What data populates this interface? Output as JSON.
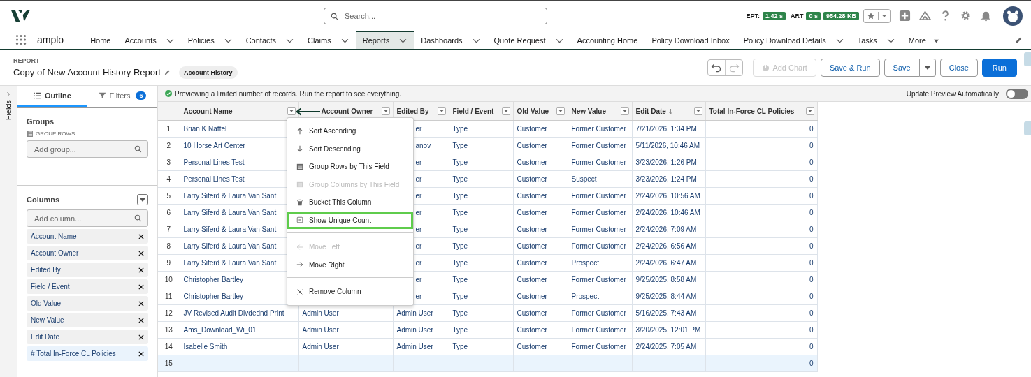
{
  "header": {
    "search_placeholder": "Search...",
    "metrics": [
      {
        "label": "EPT:",
        "value": "1.42 s"
      },
      {
        "label": "ART",
        "value": "0 s"
      },
      {
        "value": "954.28 KB"
      }
    ]
  },
  "nav": {
    "brand": "amplo",
    "items": [
      {
        "label": "Home",
        "menu": false,
        "selected": false
      },
      {
        "label": "Accounts",
        "menu": true,
        "selected": false
      },
      {
        "label": "Policies",
        "menu": true,
        "selected": false
      },
      {
        "label": "Contacts",
        "menu": true,
        "selected": false
      },
      {
        "label": "Claims",
        "menu": true,
        "selected": false
      },
      {
        "label": "Reports",
        "menu": true,
        "selected": true
      },
      {
        "label": "Dashboards",
        "menu": true,
        "selected": false
      },
      {
        "label": "Quote Request",
        "menu": true,
        "selected": false
      },
      {
        "label": "Accounting Home",
        "menu": false,
        "selected": false
      },
      {
        "label": "Policy Download Inbox",
        "menu": false,
        "selected": false
      },
      {
        "label": "Policy Download Details",
        "menu": true,
        "selected": false
      },
      {
        "label": "Tasks",
        "menu": true,
        "selected": false
      },
      {
        "label": "More",
        "menu": true,
        "selected": false,
        "kind": "more"
      }
    ]
  },
  "report": {
    "eyebrow": "REPORT",
    "title": "Copy of New Account History Report",
    "badge": "Account History",
    "buttons": [
      {
        "label": "Add Chart",
        "kind": "chart",
        "disabled": true
      },
      {
        "label": "Save & Run",
        "kind": "outline",
        "disabled": false
      },
      {
        "label": "Save",
        "kind": "split",
        "disabled": false
      },
      {
        "label": "Close",
        "kind": "outline",
        "disabled": false
      },
      {
        "label": "Run",
        "kind": "primary",
        "disabled": false
      }
    ]
  },
  "sidebar": {
    "rail_label": "Fields",
    "tabs": [
      {
        "label": "Outline",
        "selected": true
      },
      {
        "label": "Filters",
        "count": "6",
        "selected": false
      }
    ],
    "groups": {
      "title": "Groups",
      "subtitle": "GROUP ROWS",
      "placeholder": "Add group..."
    },
    "columns": {
      "title": "Columns",
      "placeholder": "Add column...",
      "items": [
        {
          "label": "Account Name",
          "selected": false
        },
        {
          "label": "Account Owner",
          "selected": false
        },
        {
          "label": "Edited By",
          "selected": false
        },
        {
          "label": "Field / Event",
          "selected": false
        },
        {
          "label": "Old Value",
          "selected": false
        },
        {
          "label": "New Value",
          "selected": false
        },
        {
          "label": "Edit Date",
          "selected": false
        },
        {
          "label": "Total In-Force CL Policies",
          "prefix": "#",
          "selected": true
        }
      ]
    }
  },
  "preview": {
    "message": "Previewing a limited number of records. Run the report to see everything.",
    "toggle_label": "Update Preview Automatically",
    "on": false
  },
  "table": {
    "columns": [
      {
        "label": "Account Name",
        "sorted": false
      },
      {
        "label": "Account Owner",
        "sorted": false
      },
      {
        "label": "Edited By",
        "sorted": false
      },
      {
        "label": "Field / Event",
        "sorted": false
      },
      {
        "label": "Old Value",
        "sorted": false
      },
      {
        "label": "New Value",
        "sorted": false
      },
      {
        "label": "Edit Date",
        "sorted": true
      },
      {
        "label": "Total In-Force CL Policies",
        "sorted": false,
        "kind": "number"
      }
    ],
    "rows": [
      {
        "n": "1",
        "cells": [
          "Brian K Naftel",
          null,
          {
            "text": "er",
            "clipped": true
          },
          "Type",
          "Customer",
          "Former Customer",
          "7/21/2026, 1:34 PM",
          "0"
        ]
      },
      {
        "n": "2",
        "cells": [
          "10 Horse Art Center",
          null,
          {
            "text": "anov",
            "clipped": true
          },
          "Type",
          "Customer",
          "Former Customer",
          "5/11/2026, 10:46 AM",
          "0"
        ]
      },
      {
        "n": "3",
        "cells": [
          "Personal Lines Test",
          null,
          {
            "text": "er",
            "clipped": true
          },
          "Type",
          "Customer",
          "Former Customer",
          "3/23/2026, 1:26 PM",
          "0"
        ]
      },
      {
        "n": "4",
        "cells": [
          "Personal Lines Test",
          null,
          {
            "text": "er",
            "clipped": true
          },
          "Type",
          "Customer",
          "Suspect",
          "3/23/2026, 1:24 PM",
          "0"
        ]
      },
      {
        "n": "5",
        "cells": [
          "Larry Siferd & Laura Van Sant",
          null,
          {
            "text": "er",
            "clipped": true
          },
          "Type",
          "Customer",
          "Former Customer",
          "2/24/2026, 10:56 AM",
          "0"
        ]
      },
      {
        "n": "6",
        "cells": [
          "Larry Siferd & Laura Van Sant",
          null,
          {
            "text": "er",
            "clipped": true
          },
          "Type",
          "Customer",
          "Former Customer",
          "2/24/2026, 10:46 AM",
          "0"
        ]
      },
      {
        "n": "7",
        "cells": [
          "Larry Siferd & Laura Van Sant",
          null,
          {
            "text": "er",
            "clipped": true
          },
          "Type",
          "Customer",
          "Former Customer",
          "2/24/2026, 7:09 AM",
          "0"
        ]
      },
      {
        "n": "8",
        "cells": [
          "Larry Siferd & Laura Van Sant",
          null,
          {
            "text": "er",
            "clipped": true
          },
          "Type",
          "Customer",
          "Former Customer",
          "2/24/2026, 6:56 AM",
          "0"
        ]
      },
      {
        "n": "9",
        "cells": [
          "Larry Siferd & Laura Van Sant",
          null,
          {
            "text": "er",
            "clipped": true
          },
          "Type",
          "Customer",
          "Prospect",
          "2/24/2026, 6:47 AM",
          "0"
        ]
      },
      {
        "n": "10",
        "cells": [
          "Christopher Bartley",
          null,
          {
            "text": "er",
            "clipped": true
          },
          "Type",
          "Customer",
          "Former Customer",
          "9/25/2025, 8:58 AM",
          "0"
        ]
      },
      {
        "n": "11",
        "cells": [
          "Christopher Bartley",
          null,
          {
            "text": "er",
            "clipped": true
          },
          "Type",
          "Customer",
          "Prospect",
          "9/25/2025, 8:44 AM",
          "0"
        ]
      },
      {
        "n": "12",
        "cells": [
          "JV Revised Audit Divdednd Print",
          "Admin User",
          "Admin User",
          "Type",
          "Customer",
          "Former Customer",
          "5/16/2025, 7:43 AM",
          "0"
        ]
      },
      {
        "n": "13",
        "cells": [
          "Ams_Download_Wi_01",
          "Admin User",
          "Admin User",
          "Type",
          "Customer",
          "Former Customer",
          "3/20/2025, 12:01 PM",
          "0"
        ]
      },
      {
        "n": "14",
        "cells": [
          "Isabelle Smith",
          "Admin User",
          "Admin User",
          "Type",
          "Customer",
          "Former Customer",
          "2/24/2025, 7:05 AM",
          "0"
        ]
      },
      {
        "n": "15",
        "kind": "total",
        "cells": [
          null,
          null,
          null,
          null,
          null,
          null,
          null,
          "0"
        ]
      }
    ]
  },
  "menu": {
    "groups": [
      [
        {
          "label": "Sort Ascending",
          "disabled": false,
          "highlighted": false
        },
        {
          "label": "Sort Descending",
          "disabled": false,
          "highlighted": false
        },
        {
          "label": "Group Rows by This Field",
          "disabled": false,
          "highlighted": false
        },
        {
          "label": "Group Columns by This Field",
          "disabled": true,
          "highlighted": false
        },
        {
          "label": "Bucket This Column",
          "disabled": false,
          "highlighted": false
        },
        {
          "label": "Show Unique Count",
          "disabled": false,
          "highlighted": true
        }
      ],
      [
        {
          "label": "Move Left",
          "disabled": true,
          "highlighted": false
        },
        {
          "label": "Move Right",
          "disabled": false,
          "highlighted": false
        }
      ],
      [
        {
          "label": "Remove Column",
          "disabled": false,
          "highlighted": false
        }
      ]
    ]
  }
}
